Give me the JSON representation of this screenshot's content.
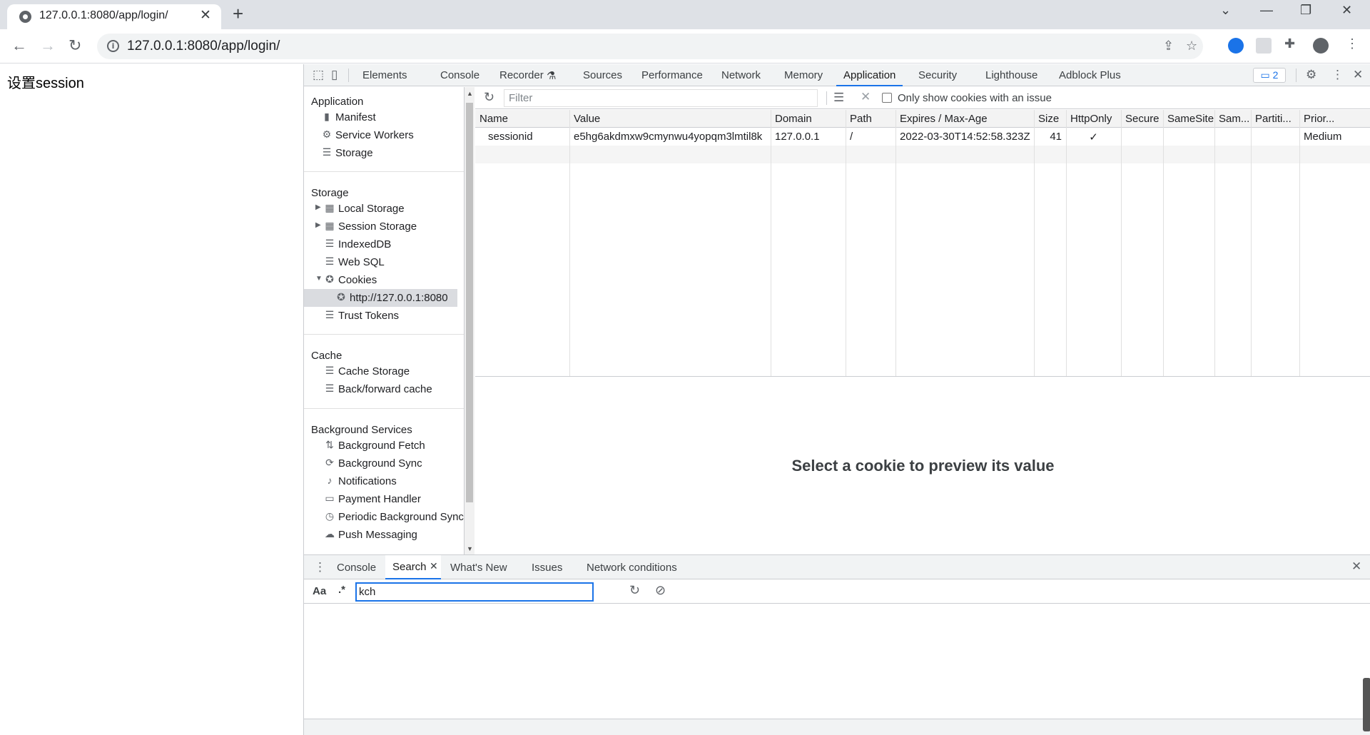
{
  "browser": {
    "tab_title": "127.0.0.1:8080/app/login/",
    "url": "127.0.0.1:8080/app/login/"
  },
  "page": {
    "heading": "设置session"
  },
  "devtools": {
    "tabs": [
      "Elements",
      "Console",
      "Recorder",
      "Sources",
      "Performance",
      "Network",
      "Memory",
      "Application",
      "Security",
      "Lighthouse",
      "Adblock Plus"
    ],
    "active_tab": "Application",
    "issues_count": "2",
    "sidebar": {
      "application_header": "Application",
      "application_items": [
        "Manifest",
        "Service Workers",
        "Storage"
      ],
      "storage_header": "Storage",
      "storage_items": [
        "Local Storage",
        "Session Storage",
        "IndexedDB",
        "Web SQL",
        "Cookies"
      ],
      "cookie_origin": "http://127.0.0.1:8080",
      "trust_tokens": "Trust Tokens",
      "cache_header": "Cache",
      "cache_items": [
        "Cache Storage",
        "Back/forward cache"
      ],
      "bg_header": "Background Services",
      "bg_items": [
        "Background Fetch",
        "Background Sync",
        "Notifications",
        "Payment Handler",
        "Periodic Background Sync",
        "Push Messaging"
      ]
    },
    "cookies_toolbar": {
      "filter_placeholder": "Filter",
      "only_issues_label": "Only show cookies with an issue"
    },
    "cookie_table": {
      "columns": [
        "Name",
        "Value",
        "Domain",
        "Path",
        "Expires / Max-Age",
        "Size",
        "HttpOnly",
        "Secure",
        "SameSite",
        "Sam...",
        "Partiti...",
        "Prior..."
      ],
      "rows": [
        [
          "sessionid",
          "e5hg6akdmxw9cmynwu4yopqm3lmtil8k",
          "127.0.0.1",
          "/",
          "2022-03-30T14:52:58.323Z",
          "41",
          "✓",
          "",
          "",
          "",
          "",
          "Medium"
        ]
      ]
    },
    "preview_message": "Select a cookie to preview its value",
    "drawer": {
      "tabs": [
        "Console",
        "Search",
        "What's New",
        "Issues",
        "Network conditions"
      ],
      "active_tab": "Search",
      "search_query": "kch",
      "case_label": "Aa",
      "regex_label": ".*"
    }
  },
  "colors": {
    "accent": "#1a73e8",
    "tabstrip": "#dee1e6"
  }
}
